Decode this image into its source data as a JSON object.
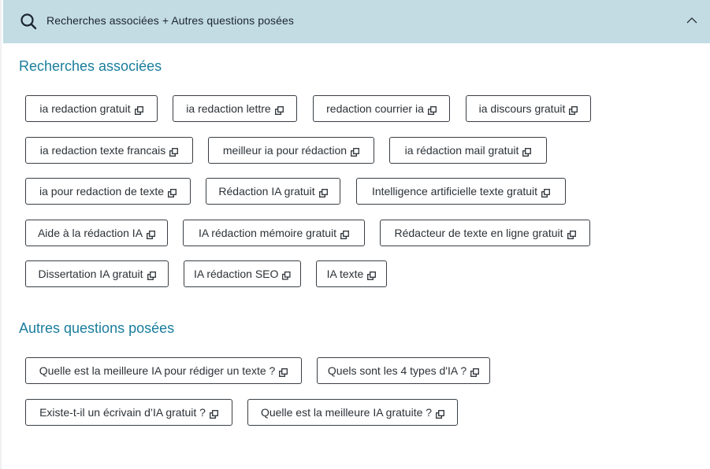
{
  "header": {
    "title": "Recherches associées + Autres questions posées",
    "search_icon": "search-icon",
    "toggle_icon": "chevron-up-icon"
  },
  "related": {
    "title": "Recherches associées",
    "items": [
      "ia redaction gratuit",
      "ia redaction lettre",
      "redaction courrier ia",
      "ia discours gratuit",
      "ia redaction texte francais",
      "meilleur ia pour rédaction",
      "ia rédaction mail gratuit",
      "ia pour redaction de texte",
      "Rédaction IA gratuit",
      "Intelligence artificielle texte gratuit",
      "Aide à la rédaction IA",
      "IA rédaction mémoire gratuit",
      "Rédacteur de texte en ligne gratuit",
      "Dissertation IA gratuit",
      "IA rédaction SEO",
      "IA texte"
    ]
  },
  "questions": {
    "title": "Autres questions posées",
    "items": [
      "Quelle est la meilleure IA pour rédiger un texte ?",
      "Quels sont les 4 types d'IA ?",
      "Existe-t-il un écrivain d’IA gratuit ?",
      "Quelle est la meilleure IA gratuite ?"
    ]
  },
  "chip_icon": "external-link-icon",
  "colors": {
    "header_bg": "#c3dce4",
    "section_title": "#1a7d9c",
    "chip_border": "#3a3f44"
  }
}
